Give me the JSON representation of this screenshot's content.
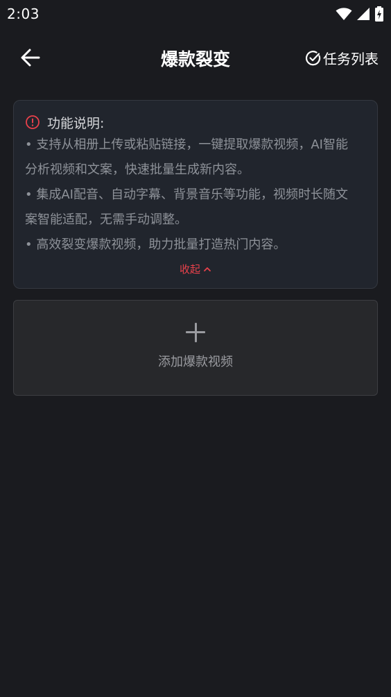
{
  "status_bar": {
    "time": "2:03",
    "icons": [
      "wifi-icon",
      "signal-icon",
      "battery-charging-icon"
    ]
  },
  "header": {
    "back_icon": "arrow-left-icon",
    "title": "爆款裂变",
    "task_list_label": "任务列表",
    "task_list_icon": "check-circle-icon"
  },
  "info_card": {
    "icon": "info-circle-icon",
    "title": "功能说明:",
    "lines": [
      "• 支持从相册上传或粘贴链接，一键提取爆款视频，AI智能",
      "分析视频和文案，快速批量生成新内容。",
      "• 集成AI配音、自动字幕、背景音乐等功能，视频时长随文",
      "案智能适配，无需手动调整。",
      "• 高效裂变爆款视频，助力批量打造热门内容。"
    ],
    "collapse_label": "收起",
    "collapse_icon": "chevron-up-icon",
    "accent_color": "#e9414b"
  },
  "add_video": {
    "icon": "plus-icon",
    "label": "添加爆款视频"
  }
}
